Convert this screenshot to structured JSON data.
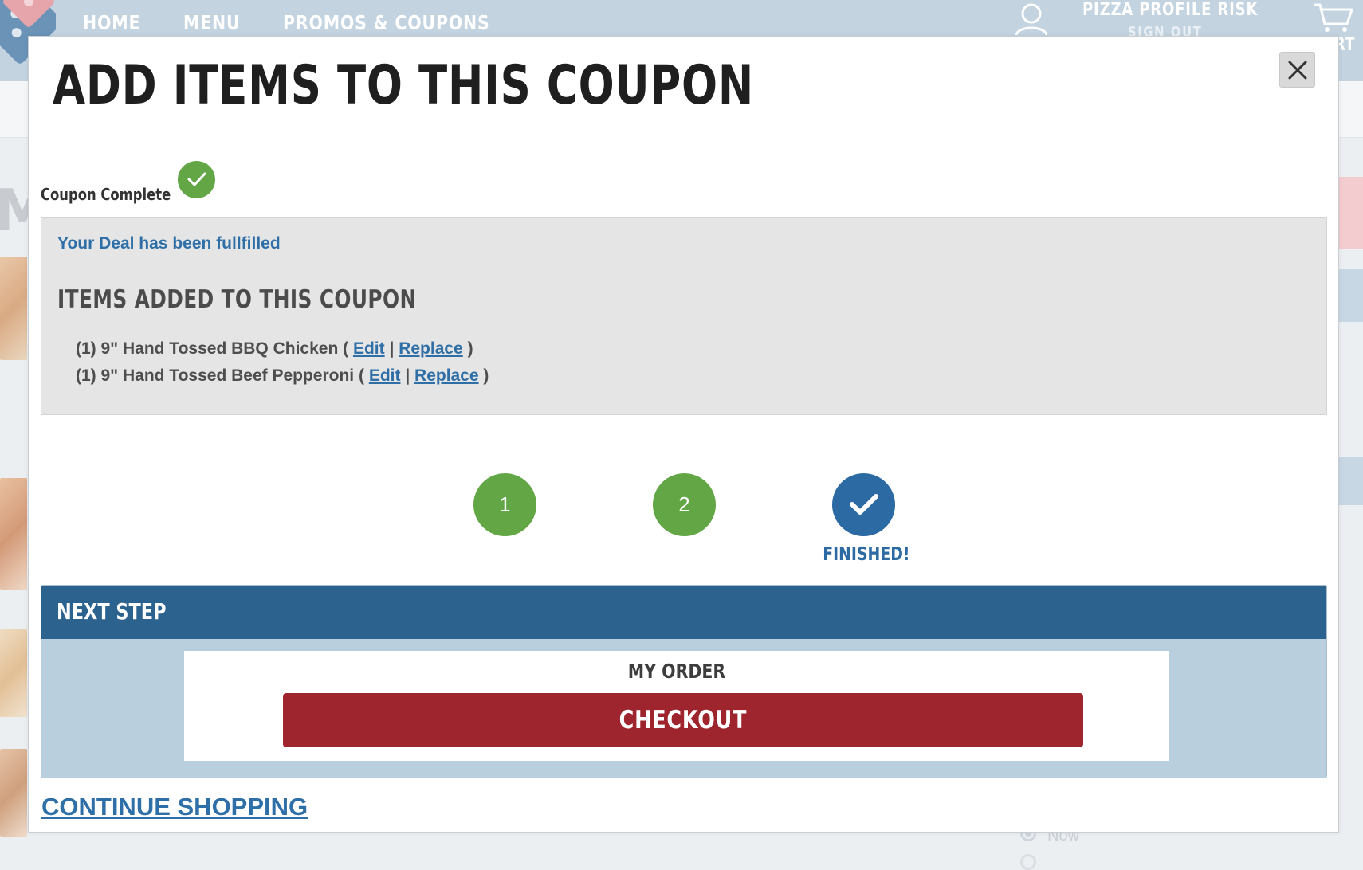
{
  "background": {
    "nav": [
      "HOME",
      "MENU",
      "PROMOS & COUPONS"
    ],
    "account_name": "PIZZA PROFILE RISK",
    "sign_out": "SIGN OUT",
    "cart_partial": "RT",
    "big_letter": "M",
    "radio_now": "Now"
  },
  "modal": {
    "title": "ADD ITEMS TO THIS COUPON",
    "close_icon": "close-icon",
    "status_label": "Coupon Complete",
    "deal_message": "Your Deal has been fullfilled",
    "items_heading": "ITEMS ADDED TO THIS COUPON",
    "items": [
      {
        "text": "(1) 9\" Hand Tossed BBQ Chicken ( ",
        "edit": "Edit",
        "sep": " | ",
        "replace": "Replace",
        "close": " )"
      },
      {
        "text": "(1) 9\" Hand Tossed Beef Pepperoni ( ",
        "edit": "Edit",
        "sep": " | ",
        "replace": "Replace",
        "close": " )"
      }
    ],
    "steps": [
      {
        "label": "1",
        "state": "complete"
      },
      {
        "label": "2",
        "state": "complete"
      },
      {
        "label": "",
        "state": "finished",
        "caption": "FINISHED!"
      }
    ],
    "next_step_title": "NEXT STEP",
    "order_label": "MY ORDER",
    "checkout_label": "CHECKOUT",
    "continue_label": "CONTINUE SHOPPING"
  },
  "colors": {
    "brand_blue": "#2b628e",
    "link_blue": "#2f6fa7",
    "success_green": "#62a646",
    "checkout_red": "#9e242d"
  }
}
